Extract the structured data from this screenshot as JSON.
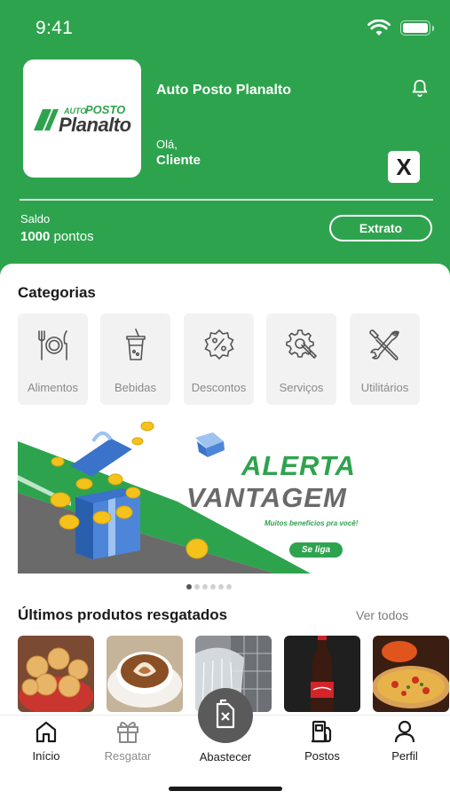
{
  "status_bar": {
    "time": "9:41"
  },
  "header": {
    "logo": {
      "auto": "AUTO",
      "posto": "POSTO",
      "name": "Planalto"
    },
    "station_name": "Auto Posto Planalto",
    "greeting": "Olá,",
    "user_name": "Cliente",
    "badge_letter": "X",
    "balance_label": "Saldo",
    "balance_points": "1000",
    "balance_unit": "pontos",
    "statement_button": "Extrato"
  },
  "categories": {
    "title": "Categorias",
    "items": [
      {
        "label": "Alimentos",
        "icon": "utensils-icon"
      },
      {
        "label": "Bebidas",
        "icon": "drink-cup-icon"
      },
      {
        "label": "Descontos",
        "icon": "discount-icon"
      },
      {
        "label": "Serviços",
        "icon": "gear-wrench-icon"
      },
      {
        "label": "Utilitários",
        "icon": "tools-icon"
      }
    ]
  },
  "banner": {
    "title_line1": "ALERTA",
    "title_line2": "VANTAGEM",
    "subtitle": "Muitos benefícios pra você!",
    "cta": "Se liga",
    "total_slides": 6,
    "active_slide": 1
  },
  "recent": {
    "title": "Últimos produtos resgatados",
    "see_all": "Ver todos",
    "products": [
      "pao-de-queijo",
      "cappuccino",
      "car-wash",
      "coca-cola",
      "pizza"
    ]
  },
  "tabbar": {
    "items": [
      {
        "label": "Início",
        "icon": "home-icon",
        "active": true
      },
      {
        "label": "Resgatar",
        "icon": "gift-icon",
        "active": false
      },
      {
        "label": "Abastecer",
        "icon": "fuel-can-icon",
        "active": false
      },
      {
        "label": "Postos",
        "icon": "gas-pump-icon",
        "active": false
      },
      {
        "label": "Perfil",
        "icon": "user-icon",
        "active": false
      }
    ]
  },
  "colors": {
    "brand_green": "#2ea34e",
    "fab_gray": "#5a5a5a"
  }
}
